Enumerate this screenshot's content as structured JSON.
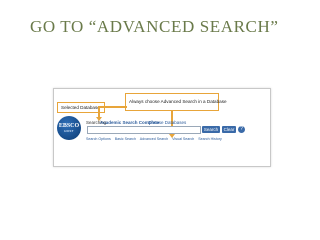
{
  "slide": {
    "title": "GO TO “ADVANCED SEARCH”"
  },
  "screenshot": {
    "logo": {
      "line1": "EBSCO",
      "line2": "HOST",
      "icon": "ebsco-logo"
    },
    "callouts": {
      "selected_database": "Selected Database",
      "always_advanced": "Always choose Advanced Search in a Database"
    },
    "searching_label": "Searching:",
    "database_name": "Academic Search Complete",
    "choose_databases": "Choose Databases",
    "search_button": "Search",
    "clear_button": "Clear",
    "help_icon": "?",
    "links": [
      "Search Options",
      "Basic Search",
      "Advanced Search",
      "Visual Search",
      "Search History"
    ],
    "accent_color": "#e8a53a"
  }
}
